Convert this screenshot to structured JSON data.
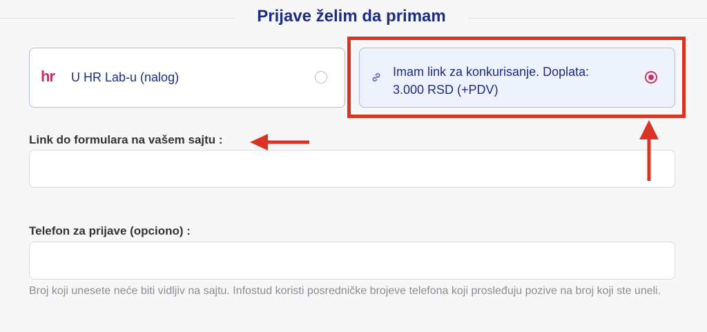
{
  "section": {
    "title": "Prijave želim da primam"
  },
  "options": [
    {
      "logo_text": "hr",
      "label": "U HR Lab-u (nalog)",
      "selected": false,
      "icon": "hr-lab-logo"
    },
    {
      "label": "Imam link za konkurisanje. Doplata: 3.000 RSD (+PDV)",
      "selected": true,
      "icon": "link-icon"
    }
  ],
  "form": {
    "link_label": "Link do formulara na vašem sajtu :",
    "link_value": "",
    "phone_label": "Telefon za prijave (opciono) :",
    "phone_value": "",
    "phone_help": "Broj koji unesete neće biti vidljiv na sajtu. Infostud koristi posredničke brojeve telefona koji prosleđuju pozive na broj koji ste uneli."
  },
  "colors": {
    "brand_navy": "#1d2d7e",
    "brand_pink": "#d22c68",
    "annotation_red": "#d83324"
  }
}
